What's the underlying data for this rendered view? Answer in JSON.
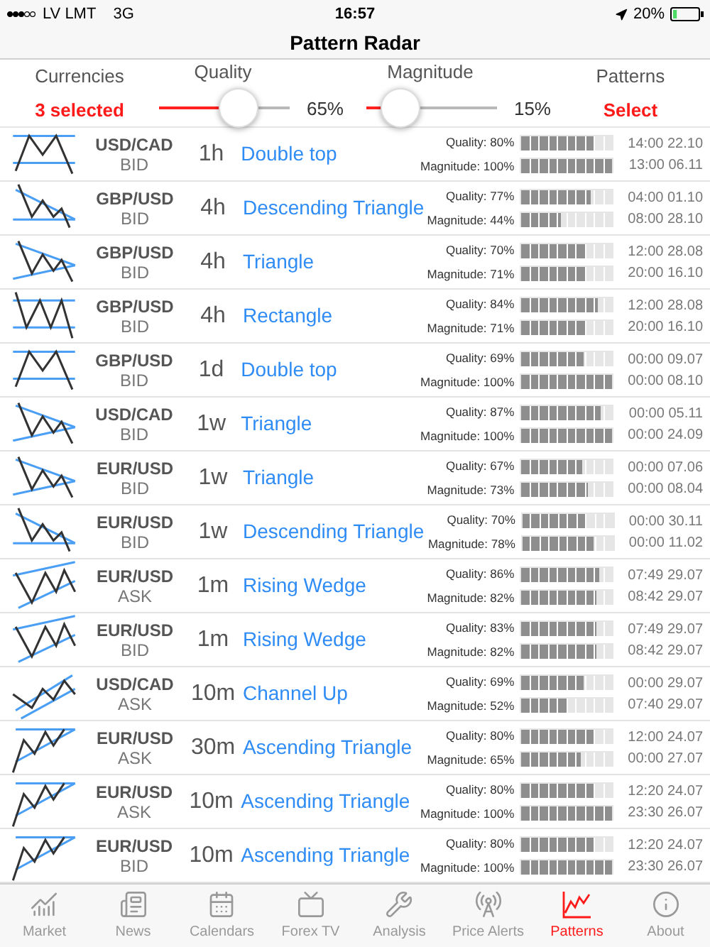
{
  "status_bar": {
    "carrier": "LV LMT",
    "network": "3G",
    "time": "16:57",
    "battery": "20%"
  },
  "title": "Pattern Radar",
  "filters": [
    {
      "kind": "text",
      "label": "Currencies",
      "value": "3 selected"
    },
    {
      "kind": "slider",
      "label": "Quality",
      "level": 0.65,
      "reading": "65%"
    },
    {
      "kind": "slider",
      "label": "Magnitude",
      "level": 0.15,
      "reading": "15%"
    },
    {
      "kind": "text",
      "label": "Patterns",
      "value": "Select"
    }
  ],
  "rows": [
    {
      "kind": "double_top",
      "pair": "USD/CAD",
      "side": "BID",
      "timeframe": "1h",
      "pattern": "Double top",
      "quality": "Quality: 80%",
      "quality_bar": {
        "level": 0.8
      },
      "magnitude": "Magnitude: 100%",
      "magnitude_bar": {
        "level": 1
      },
      "start": "14:00 22.10",
      "end": "13:00 06.11"
    },
    {
      "kind": "descending_triangle",
      "pair": "GBP/USD",
      "side": "BID",
      "timeframe": "4h",
      "pattern": "Descending Triangle",
      "quality": "Quality: 77%",
      "quality_bar": {
        "level": 0.77
      },
      "magnitude": "Magnitude: 44%",
      "magnitude_bar": {
        "level": 0.44
      },
      "start": "04:00 01.10",
      "end": "08:00 28.10"
    },
    {
      "kind": "triangle",
      "pair": "GBP/USD",
      "side": "BID",
      "timeframe": "4h",
      "pattern": "Triangle",
      "quality": "Quality: 70%",
      "quality_bar": {
        "level": 0.7
      },
      "magnitude": "Magnitude: 71%",
      "magnitude_bar": {
        "level": 0.71
      },
      "start": "12:00 28.08",
      "end": "20:00 16.10"
    },
    {
      "kind": "rectangle",
      "pair": "GBP/USD",
      "side": "BID",
      "timeframe": "4h",
      "pattern": "Rectangle",
      "quality": "Quality: 84%",
      "quality_bar": {
        "level": 0.84
      },
      "magnitude": "Magnitude: 71%",
      "magnitude_bar": {
        "level": 0.71
      },
      "start": "12:00 28.08",
      "end": "20:00 16.10"
    },
    {
      "kind": "double_top",
      "pair": "GBP/USD",
      "side": "BID",
      "timeframe": "1d",
      "pattern": "Double top",
      "quality": "Quality: 69%",
      "quality_bar": {
        "level": 0.69
      },
      "magnitude": "Magnitude: 100%",
      "magnitude_bar": {
        "level": 1
      },
      "start": "00:00 09.07",
      "end": "00:00 08.10"
    },
    {
      "kind": "triangle",
      "pair": "USD/CAD",
      "side": "BID",
      "timeframe": "1w",
      "pattern": "Triangle",
      "quality": "Quality: 87%",
      "quality_bar": {
        "level": 0.87
      },
      "magnitude": "Magnitude: 100%",
      "magnitude_bar": {
        "level": 1
      },
      "start": "00:00 05.11",
      "end": "00:00 24.09"
    },
    {
      "kind": "triangle",
      "pair": "EUR/USD",
      "side": "BID",
      "timeframe": "1w",
      "pattern": "Triangle",
      "quality": "Quality: 67%",
      "quality_bar": {
        "level": 0.67
      },
      "magnitude": "Magnitude: 73%",
      "magnitude_bar": {
        "level": 0.73
      },
      "start": "00:00 07.06",
      "end": "00:00 08.04"
    },
    {
      "kind": "descending_triangle",
      "pair": "EUR/USD",
      "side": "BID",
      "timeframe": "1w",
      "pattern": "Descending Triangle",
      "quality": "Quality: 70%",
      "quality_bar": {
        "level": 0.7
      },
      "magnitude": "Magnitude: 78%",
      "magnitude_bar": {
        "level": 0.78
      },
      "start": "00:00 30.11",
      "end": "00:00 11.02"
    },
    {
      "kind": "rising_wedge",
      "pair": "EUR/USD",
      "side": "ASK",
      "timeframe": "1m",
      "pattern": "Rising Wedge",
      "quality": "Quality: 86%",
      "quality_bar": {
        "level": 0.86
      },
      "magnitude": "Magnitude: 82%",
      "magnitude_bar": {
        "level": 0.82
      },
      "start": "07:49 29.07",
      "end": "08:42 29.07"
    },
    {
      "kind": "rising_wedge",
      "pair": "EUR/USD",
      "side": "BID",
      "timeframe": "1m",
      "pattern": "Rising Wedge",
      "quality": "Quality: 83%",
      "quality_bar": {
        "level": 0.83
      },
      "magnitude": "Magnitude: 82%",
      "magnitude_bar": {
        "level": 0.82
      },
      "start": "07:49 29.07",
      "end": "08:42 29.07"
    },
    {
      "kind": "channel_up",
      "pair": "USD/CAD",
      "side": "ASK",
      "timeframe": "10m",
      "pattern": "Channel Up",
      "quality": "Quality: 69%",
      "quality_bar": {
        "level": 0.69
      },
      "magnitude": "Magnitude: 52%",
      "magnitude_bar": {
        "level": 0.52
      },
      "start": "00:00 29.07",
      "end": "07:40 29.07"
    },
    {
      "kind": "ascending_triangle",
      "pair": "EUR/USD",
      "side": "ASK",
      "timeframe": "30m",
      "pattern": "Ascending Triangle",
      "quality": "Quality: 80%",
      "quality_bar": {
        "level": 0.8
      },
      "magnitude": "Magnitude: 65%",
      "magnitude_bar": {
        "level": 0.65
      },
      "start": "12:00 24.07",
      "end": "00:00 27.07"
    },
    {
      "kind": "ascending_triangle",
      "pair": "EUR/USD",
      "side": "ASK",
      "timeframe": "10m",
      "pattern": "Ascending Triangle",
      "quality": "Quality: 80%",
      "quality_bar": {
        "level": 0.8
      },
      "magnitude": "Magnitude: 100%",
      "magnitude_bar": {
        "level": 1
      },
      "start": "12:20 24.07",
      "end": "23:30 26.07"
    },
    {
      "kind": "ascending_triangle",
      "pair": "EUR/USD",
      "side": "BID",
      "timeframe": "10m",
      "pattern": "Ascending Triangle",
      "quality": "Quality: 80%",
      "quality_bar": {
        "level": 0.8
      },
      "magnitude": "Magnitude: 100%",
      "magnitude_bar": {
        "level": 1
      },
      "start": "12:20 24.07",
      "end": "23:30 26.07"
    }
  ],
  "tab_bar": [
    {
      "kind": "market",
      "label": "Market",
      "selected": false
    },
    {
      "kind": "news",
      "label": "News",
      "selected": false
    },
    {
      "kind": "calendars",
      "label": "Calendars",
      "selected": false
    },
    {
      "kind": "tv",
      "label": "Forex TV",
      "selected": false
    },
    {
      "kind": "analysis",
      "label": "Analysis",
      "selected": false
    },
    {
      "kind": "alerts",
      "label": "Price Alerts",
      "selected": false
    },
    {
      "kind": "patterns",
      "label": "Patterns",
      "selected": true
    },
    {
      "kind": "about",
      "label": "About",
      "selected": false
    }
  ]
}
